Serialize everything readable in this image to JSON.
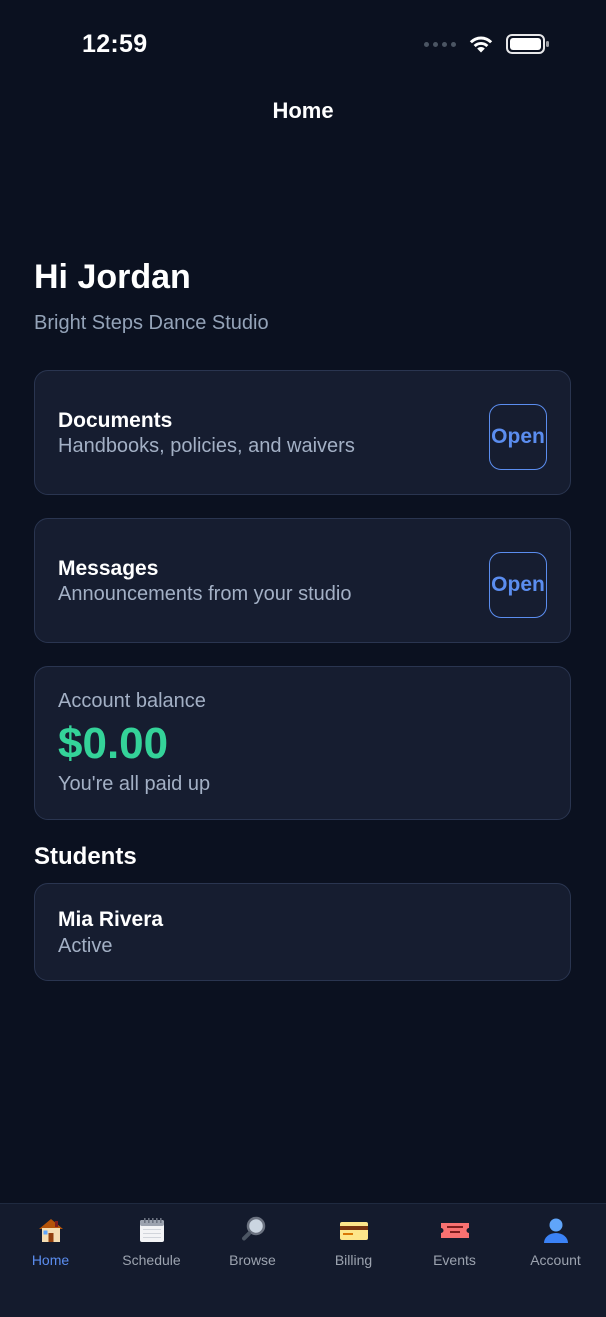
{
  "status_bar": {
    "time": "12:59"
  },
  "nav": {
    "title": "Home"
  },
  "greeting": {
    "title": "Hi Jordan",
    "studio": "Bright Steps Dance Studio"
  },
  "cards": {
    "documents": {
      "title": "Documents",
      "subtitle": "Handbooks, policies, and waivers",
      "button": "Open"
    },
    "messages": {
      "title": "Messages",
      "subtitle": "Announcements from your studio",
      "button": "Open"
    },
    "balance": {
      "label": "Account balance",
      "amount": "$0.00",
      "status": "You're all paid up"
    }
  },
  "students": {
    "heading": "Students",
    "items": [
      {
        "name": "Mia Rivera",
        "status": "Active"
      }
    ]
  },
  "tabs": [
    {
      "label": "Home",
      "icon": "house-icon",
      "active": true
    },
    {
      "label": "Schedule",
      "icon": "calendar-icon",
      "active": false
    },
    {
      "label": "Browse",
      "icon": "magnifier-icon",
      "active": false
    },
    {
      "label": "Billing",
      "icon": "credit-card-icon",
      "active": false
    },
    {
      "label": "Events",
      "icon": "ticket-icon",
      "active": false
    },
    {
      "label": "Account",
      "icon": "person-icon",
      "active": false
    }
  ],
  "colors": {
    "background": "#0b1120",
    "card": "#161d30",
    "accent": "#5b8def",
    "balance_green": "#34d399"
  }
}
